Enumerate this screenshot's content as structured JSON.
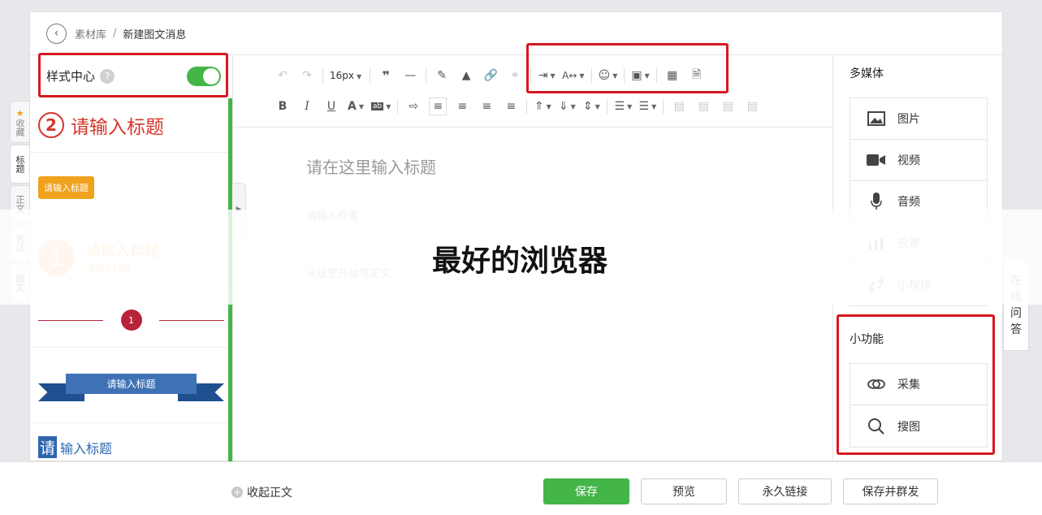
{
  "header": {
    "back_icon": "back-arrow-icon",
    "breadcrumb_link": "素材库",
    "breadcrumb_sep": "/",
    "breadcrumb_current": "新建图文消息"
  },
  "style_center": {
    "title": "样式中心",
    "help": "?",
    "toggle_on": true,
    "items": [
      {
        "num": "2",
        "text": "请输入标题"
      },
      {
        "text": "请输入标题"
      },
      {
        "num": "1",
        "text": "请输入标题",
        "sub": "请输入标题"
      },
      {
        "num": "1"
      },
      {
        "text": "请输入标题"
      },
      {
        "first_char": "请",
        "rest": "输入标题"
      }
    ]
  },
  "side_tabs": [
    {
      "label": "收藏",
      "icon": "★"
    },
    {
      "label": "标题"
    },
    {
      "label": "正文"
    },
    {
      "label": "关注"
    },
    {
      "label": "图文"
    }
  ],
  "toolbar": {
    "font_size": "16px"
  },
  "editor": {
    "title_placeholder": "请在这里输入标题",
    "author_placeholder": "请输入作者",
    "body_placeholder": "从这里开始写正文"
  },
  "right_panel": {
    "media_title": "多媒体",
    "media_items": [
      {
        "label": "图片",
        "icon": "image-icon",
        "enabled": true
      },
      {
        "label": "视频",
        "icon": "video-icon",
        "enabled": true
      },
      {
        "label": "音频",
        "icon": "microphone-icon",
        "enabled": true
      },
      {
        "label": "投票",
        "icon": "poll-icon",
        "enabled": false
      },
      {
        "label": "小程序",
        "icon": "link-icon",
        "enabled": false
      }
    ],
    "tools_title": "小功能",
    "tool_items": [
      {
        "label": "采集",
        "icon": "collect-icon"
      },
      {
        "label": "搜图",
        "icon": "search-icon"
      }
    ]
  },
  "qa_tab": {
    "chars": [
      "在",
      "线",
      "问",
      "答"
    ]
  },
  "bottom_bar": {
    "collapse_label": "收起正文",
    "save": "保存",
    "preview": "预览",
    "permalink": "永久链接",
    "save_and_send": "保存并群发"
  },
  "overlay_caption": "最好的浏览器",
  "colors": {
    "accent_green": "#44b549",
    "highlight_red": "#d7181f"
  }
}
